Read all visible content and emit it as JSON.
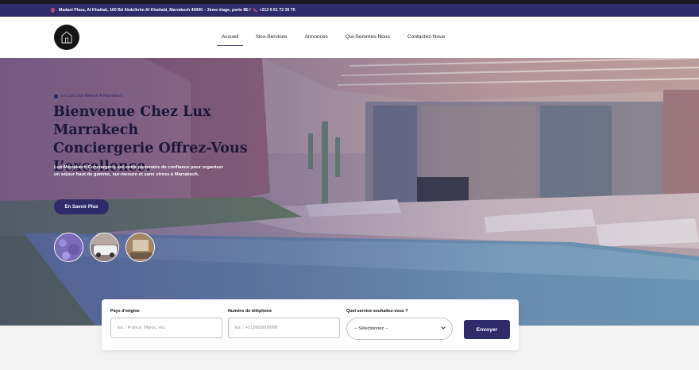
{
  "colors": {
    "brand": "#2f2a6a",
    "accent_pink": "#e0567a",
    "headline": "#1b1738"
  },
  "topbar": {
    "address": "Madani Plaza, Al Khattab, 160 Bd Abdelkrim Al Khattabi, Marrakech 40000 – 3ème étage, porte 8E /",
    "phone": "+212 6 61 72 39 75",
    "address_icon": "location-pin-icon",
    "phone_icon": "phone-icon"
  },
  "header": {
    "logo_icon": "house-logo-icon",
    "nav": [
      {
        "label": "Accueil",
        "active": true
      },
      {
        "label": "Nos-Services"
      },
      {
        "label": "Annonces"
      },
      {
        "label": "Qui-Sommes-Nous"
      },
      {
        "label": "Contactez-Nous"
      }
    ]
  },
  "hero": {
    "eyebrow": "Le Luxe Sur Mesure À Marrakech",
    "title_line1": "Bienvenue Chez Lux Marrakech",
    "title_line2": "Conciergerie Offrez-Vous",
    "title_line3": "L’excellence.",
    "description": "Lux Marrakech Conciergerie est votre partenaire de confiance pour organiser un séjour haut de gamme, sur-mesure et sans stress à Marrakech.",
    "cta_label": "En Savoir Plus"
  },
  "form": {
    "country_label": "Pays d'origine",
    "country_placeholder": "Ex. : France, Maroc, etc.",
    "phone_label": "Numéro de téléphone",
    "phone_placeholder": "Ex. : +212600000000",
    "service_label": "Quel service souhaitez-vous ?",
    "service_selected": "-- Sélectionnez --",
    "submit_label": "Envoyer"
  }
}
